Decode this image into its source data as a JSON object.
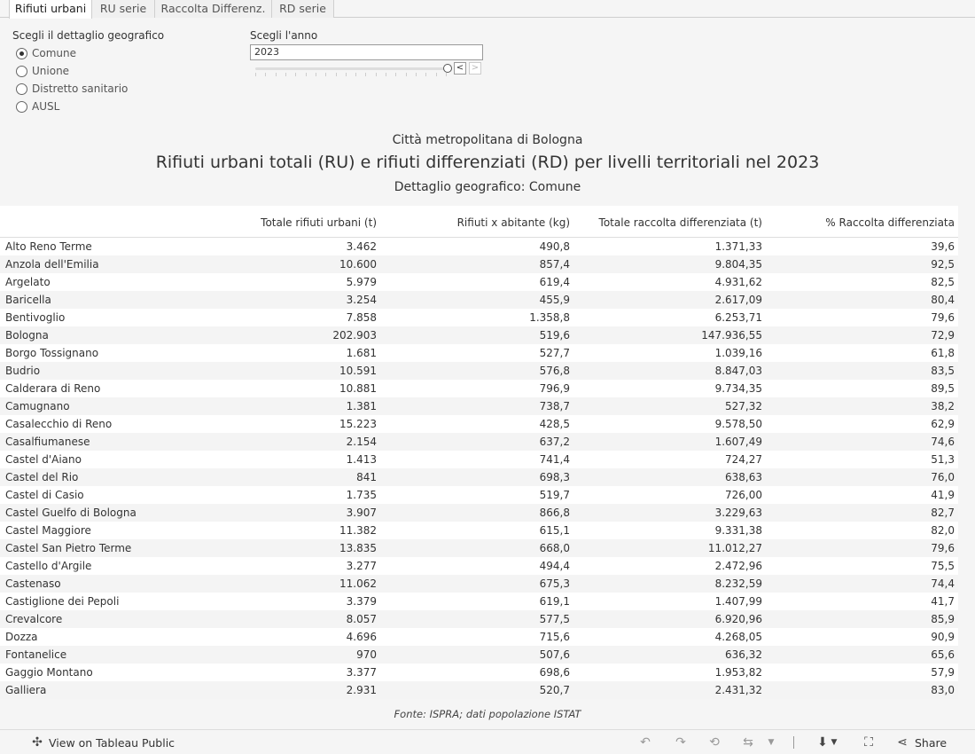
{
  "tabs": [
    {
      "label": "Rifiuti urbani",
      "active": true
    },
    {
      "label": "RU serie",
      "active": false
    },
    {
      "label": "Raccolta Differenz.",
      "active": false
    },
    {
      "label": "RD serie",
      "active": false
    }
  ],
  "geo_filter": {
    "title": "Scegli il dettaglio geografico",
    "options": [
      {
        "label": "Comune",
        "selected": true
      },
      {
        "label": "Unione",
        "selected": false
      },
      {
        "label": "Distretto sanitario",
        "selected": false
      },
      {
        "label": "AUSL",
        "selected": false
      }
    ]
  },
  "year_filter": {
    "title": "Scegli l'anno",
    "value": "2023",
    "prev_label": "<",
    "next_label": ">"
  },
  "headings": {
    "subtitle": "Città metropolitana di Bologna",
    "title": "Rifiuti urbani totali (RU) e rifiuti differenziati (RD) per livelli territoriali nel 2023",
    "detail": "Dettaglio geografico: Comune"
  },
  "table": {
    "columns": [
      "",
      "Totale rifiuti urbani (t)",
      "Rifiuti x abitante (kg)",
      "Totale raccolta differenziata (t)",
      "% Raccolta differenziata"
    ],
    "rows": [
      [
        "Alto Reno Terme",
        "3.462",
        "490,8",
        "1.371,33",
        "39,6"
      ],
      [
        "Anzola dell'Emilia",
        "10.600",
        "857,4",
        "9.804,35",
        "92,5"
      ],
      [
        "Argelato",
        "5.979",
        "619,4",
        "4.931,62",
        "82,5"
      ],
      [
        "Baricella",
        "3.254",
        "455,9",
        "2.617,09",
        "80,4"
      ],
      [
        "Bentivoglio",
        "7.858",
        "1.358,8",
        "6.253,71",
        "79,6"
      ],
      [
        "Bologna",
        "202.903",
        "519,6",
        "147.936,55",
        "72,9"
      ],
      [
        "Borgo Tossignano",
        "1.681",
        "527,7",
        "1.039,16",
        "61,8"
      ],
      [
        "Budrio",
        "10.591",
        "576,8",
        "8.847,03",
        "83,5"
      ],
      [
        "Calderara di Reno",
        "10.881",
        "796,9",
        "9.734,35",
        "89,5"
      ],
      [
        "Camugnano",
        "1.381",
        "738,7",
        "527,32",
        "38,2"
      ],
      [
        "Casalecchio di Reno",
        "15.223",
        "428,5",
        "9.578,50",
        "62,9"
      ],
      [
        "Casalfiumanese",
        "2.154",
        "637,2",
        "1.607,49",
        "74,6"
      ],
      [
        "Castel d'Aiano",
        "1.413",
        "741,4",
        "724,27",
        "51,3"
      ],
      [
        "Castel del Rio",
        "841",
        "698,3",
        "638,63",
        "76,0"
      ],
      [
        "Castel di Casio",
        "1.735",
        "519,7",
        "726,00",
        "41,9"
      ],
      [
        "Castel Guelfo di Bologna",
        "3.907",
        "866,8",
        "3.229,63",
        "82,7"
      ],
      [
        "Castel Maggiore",
        "11.382",
        "615,1",
        "9.331,38",
        "82,0"
      ],
      [
        "Castel San Pietro Terme",
        "13.835",
        "668,0",
        "11.012,27",
        "79,6"
      ],
      [
        "Castello d'Argile",
        "3.277",
        "494,4",
        "2.472,96",
        "75,5"
      ],
      [
        "Castenaso",
        "11.062",
        "675,3",
        "8.232,59",
        "74,4"
      ],
      [
        "Castiglione dei Pepoli",
        "3.379",
        "619,1",
        "1.407,99",
        "41,7"
      ],
      [
        "Crevalcore",
        "8.057",
        "577,5",
        "6.920,96",
        "85,9"
      ],
      [
        "Dozza",
        "4.696",
        "715,6",
        "4.268,05",
        "90,9"
      ],
      [
        "Fontanelice",
        "970",
        "507,6",
        "636,32",
        "65,6"
      ],
      [
        "Gaggio Montano",
        "3.377",
        "698,6",
        "1.953,82",
        "57,9"
      ],
      [
        "Galliera",
        "2.931",
        "520,7",
        "2.431,32",
        "83,0"
      ]
    ]
  },
  "source": "Fonte: ISPRA; dati popolazione ISTAT",
  "toolbar": {
    "view_label": "View on Tableau Public",
    "share_label": "Share"
  }
}
